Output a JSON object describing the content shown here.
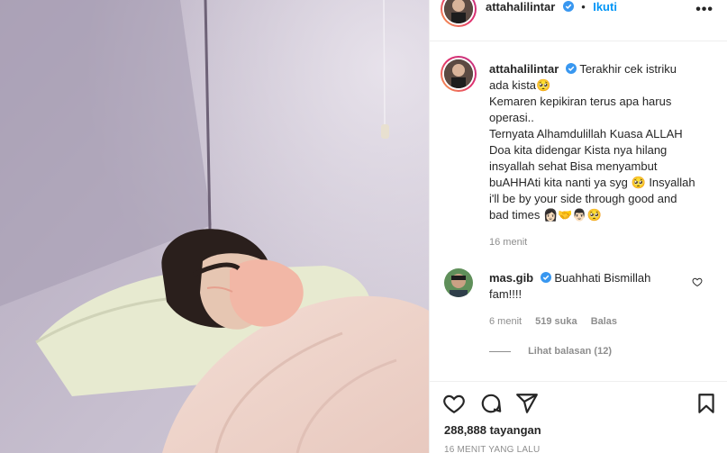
{
  "post": {
    "username": "attahalilintar",
    "follow_label": "Ikuti",
    "more_label": "•••",
    "caption_lines": [
      "Terakhir cek istriku",
      "ada kista🥺",
      "Kemaren kepikiran terus apa harus",
      "operasi..",
      "Ternyata Alhamdulillah Kuasa ALLAH",
      "Doa kita didengar Kista nya hilang",
      "insyallah sehat Bisa menyambut",
      "buAHHAti kita nanti ya syg 🥺 Insyallah",
      "i'll be by your side through good and",
      "bad times 👩🏻‍🤝‍👨🏻🥺"
    ],
    "caption_time": "16 menit"
  },
  "comment": {
    "username": "mas.gib",
    "text_line1": "Buahhati Bismillah",
    "text_line2": "fam!!!!",
    "time": "6 menit",
    "likes": "519 suka",
    "reply_label": "Balas",
    "view_replies": "Lihat balasan (12)"
  },
  "actions": {
    "views": "288,888 tayangan",
    "posted": "16 MENIT YANG LALU"
  },
  "colors": {
    "accent": "#0095f6",
    "verified": "#3897f0",
    "muted": "#8e8e8e"
  },
  "icons": [
    "heart-icon",
    "comment-icon",
    "share-icon",
    "bookmark-icon",
    "verified-icon",
    "more-icon"
  ]
}
